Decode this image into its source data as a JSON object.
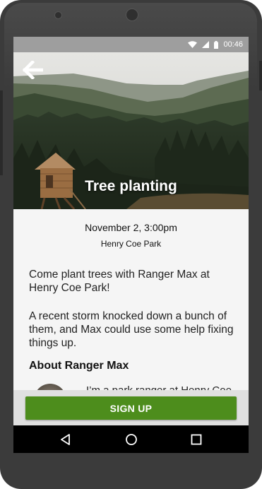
{
  "status_bar": {
    "time": "00:46",
    "icons": [
      "wifi-icon",
      "signal-icon",
      "battery-icon"
    ]
  },
  "header": {
    "back_icon": "arrow-left-icon",
    "title": "Tree planting"
  },
  "event": {
    "date": "November 2, 3:00pm",
    "location": "Henry Coe Park",
    "description": [
      "Come plant trees with Ranger Max at Henry Coe Park!",
      "A recent storm knocked down a bunch of them, and Max could use some help fixing things up."
    ]
  },
  "about": {
    "title": "About Ranger Max",
    "bio": "I’m a park ranger at Henry Coe"
  },
  "actions": {
    "signup_label": "SIGN UP"
  },
  "nav": {
    "icons": [
      "back-triangle-icon",
      "home-circle-icon",
      "recents-square-icon"
    ]
  },
  "colors": {
    "accent": "#4d8d1c",
    "status_bar": "#9e9e9e",
    "nav_bar": "#000000",
    "device": "#3b3b3b"
  }
}
